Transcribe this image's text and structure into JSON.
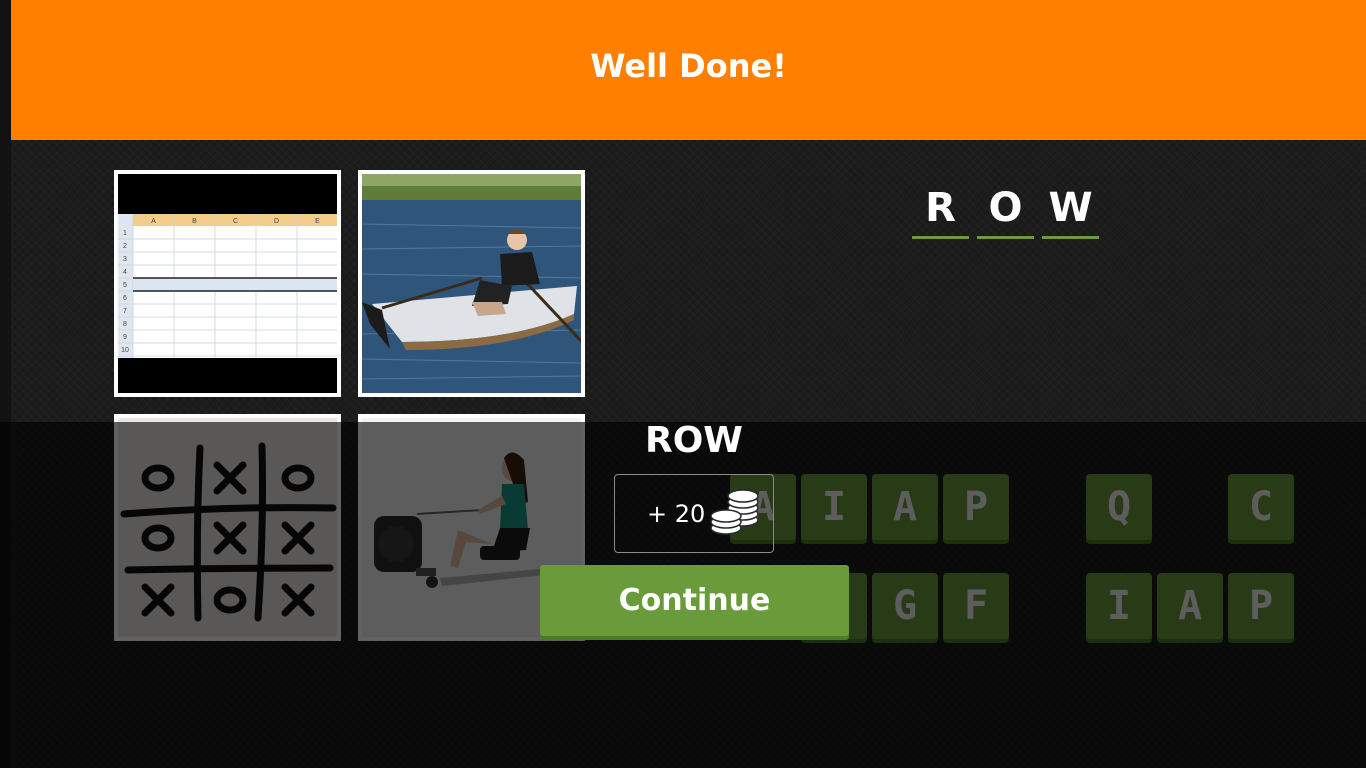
{
  "banner": {
    "title": "Well Done!"
  },
  "answer": {
    "letters": [
      "R",
      "O",
      "W"
    ]
  },
  "keyboard": {
    "row1": [
      "A",
      "I",
      "A",
      "P",
      "Q",
      "C"
    ],
    "row2": [
      "G",
      "F",
      "I",
      "A",
      "P"
    ]
  },
  "result": {
    "word": "ROW",
    "reward_text": "+ 20",
    "continue_label": "Continue"
  },
  "spreadsheet": {
    "columns": [
      "A",
      "B",
      "C",
      "D",
      "E"
    ],
    "rows": [
      "1",
      "2",
      "3",
      "4",
      "5",
      "6",
      "7",
      "8",
      "9",
      "10"
    ]
  },
  "tictactoe": {
    "cells": [
      "O",
      "X",
      "O",
      "O",
      "X",
      "X",
      "X",
      "O",
      "X"
    ]
  },
  "colors": {
    "banner": "#ff8000",
    "accent_green": "#6a9b3a",
    "background": "#1c1c1c"
  }
}
